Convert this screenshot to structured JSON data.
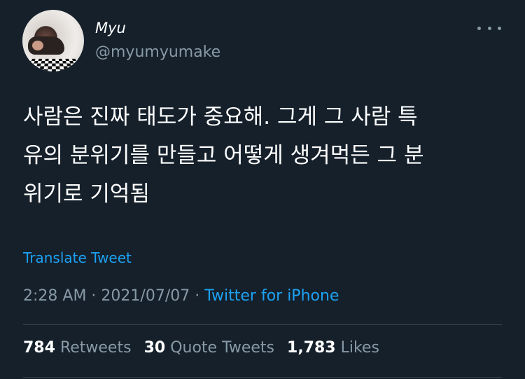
{
  "author": {
    "name": "Myu",
    "handle": "@myumyumake"
  },
  "tweet": {
    "lines": [
      "사람은 진짜 태도가 중요해. 그게 그 사람 특",
      "유의 분위기를 만들고 어떻게 생겨먹든 그 분",
      "위기로 기억됨"
    ]
  },
  "translate_label": "Translate Tweet",
  "meta": {
    "time": "2:28 AM",
    "separator": " · ",
    "date": "2021/07/07",
    "source": "Twitter for iPhone"
  },
  "stats": {
    "retweets_count": "784",
    "retweets_label": "Retweets",
    "quotes_count": "30",
    "quotes_label": "Quote Tweets",
    "likes_count": "1,783",
    "likes_label": "Likes"
  },
  "colors": {
    "background": "#15202b",
    "accent": "#1da1f2",
    "secondary_text": "#8899a6"
  },
  "icons": [
    "more-options-icon"
  ]
}
